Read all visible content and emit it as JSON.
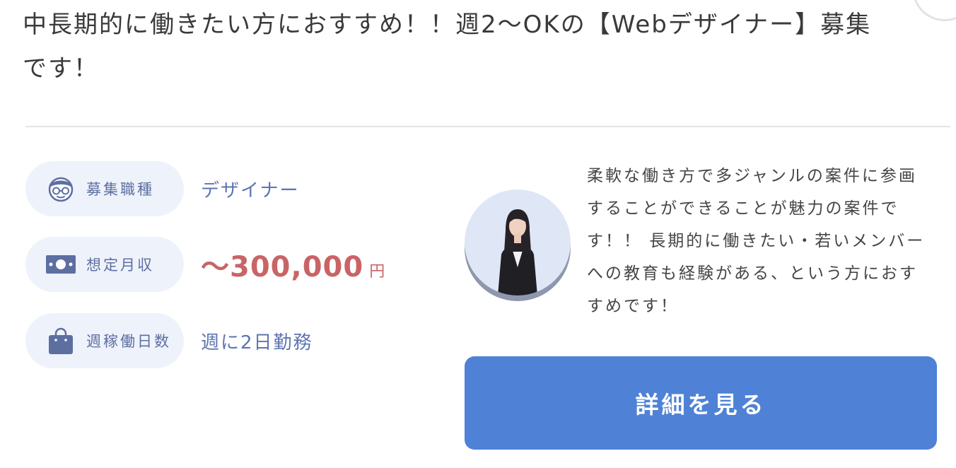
{
  "job": {
    "title": "中長期的に働きたい方におすすめ！！週2〜OKの【Webデザイナー】募集です！"
  },
  "specs": [
    {
      "icon": "person-with-glasses-icon",
      "label": "募集職種",
      "value": "デザイナー"
    },
    {
      "icon": "banknote-icon",
      "label": "想定月収",
      "value": "〜300,000",
      "unit": "円"
    },
    {
      "icon": "shopping-bag-icon",
      "label": "週稼働日数",
      "value": "週に2日勤務"
    }
  ],
  "description": "柔軟な働き方で多ジャンルの案件に参画することができることが魅力の案件です！！ 長期的に働きたい・若いメンバーへの教育も経験がある、という方におすすめです！",
  "cta": {
    "label": "詳細を見る"
  },
  "colors": {
    "accent": "#4f82d6",
    "salary": "#c96466",
    "value_text": "#5d74b2",
    "pill_background": "#eef2fb",
    "icon": "#5d6fa1"
  }
}
